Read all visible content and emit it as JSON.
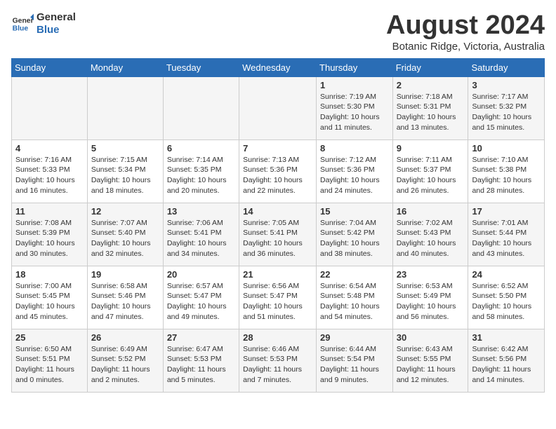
{
  "header": {
    "logo_line1": "General",
    "logo_line2": "Blue",
    "month_title": "August 2024",
    "subtitle": "Botanic Ridge, Victoria, Australia"
  },
  "weekdays": [
    "Sunday",
    "Monday",
    "Tuesday",
    "Wednesday",
    "Thursday",
    "Friday",
    "Saturday"
  ],
  "weeks": [
    [
      {
        "day": "",
        "info": ""
      },
      {
        "day": "",
        "info": ""
      },
      {
        "day": "",
        "info": ""
      },
      {
        "day": "",
        "info": ""
      },
      {
        "day": "1",
        "info": "Sunrise: 7:19 AM\nSunset: 5:30 PM\nDaylight: 10 hours\nand 11 minutes."
      },
      {
        "day": "2",
        "info": "Sunrise: 7:18 AM\nSunset: 5:31 PM\nDaylight: 10 hours\nand 13 minutes."
      },
      {
        "day": "3",
        "info": "Sunrise: 7:17 AM\nSunset: 5:32 PM\nDaylight: 10 hours\nand 15 minutes."
      }
    ],
    [
      {
        "day": "4",
        "info": "Sunrise: 7:16 AM\nSunset: 5:33 PM\nDaylight: 10 hours\nand 16 minutes."
      },
      {
        "day": "5",
        "info": "Sunrise: 7:15 AM\nSunset: 5:34 PM\nDaylight: 10 hours\nand 18 minutes."
      },
      {
        "day": "6",
        "info": "Sunrise: 7:14 AM\nSunset: 5:35 PM\nDaylight: 10 hours\nand 20 minutes."
      },
      {
        "day": "7",
        "info": "Sunrise: 7:13 AM\nSunset: 5:36 PM\nDaylight: 10 hours\nand 22 minutes."
      },
      {
        "day": "8",
        "info": "Sunrise: 7:12 AM\nSunset: 5:36 PM\nDaylight: 10 hours\nand 24 minutes."
      },
      {
        "day": "9",
        "info": "Sunrise: 7:11 AM\nSunset: 5:37 PM\nDaylight: 10 hours\nand 26 minutes."
      },
      {
        "day": "10",
        "info": "Sunrise: 7:10 AM\nSunset: 5:38 PM\nDaylight: 10 hours\nand 28 minutes."
      }
    ],
    [
      {
        "day": "11",
        "info": "Sunrise: 7:08 AM\nSunset: 5:39 PM\nDaylight: 10 hours\nand 30 minutes."
      },
      {
        "day": "12",
        "info": "Sunrise: 7:07 AM\nSunset: 5:40 PM\nDaylight: 10 hours\nand 32 minutes."
      },
      {
        "day": "13",
        "info": "Sunrise: 7:06 AM\nSunset: 5:41 PM\nDaylight: 10 hours\nand 34 minutes."
      },
      {
        "day": "14",
        "info": "Sunrise: 7:05 AM\nSunset: 5:41 PM\nDaylight: 10 hours\nand 36 minutes."
      },
      {
        "day": "15",
        "info": "Sunrise: 7:04 AM\nSunset: 5:42 PM\nDaylight: 10 hours\nand 38 minutes."
      },
      {
        "day": "16",
        "info": "Sunrise: 7:02 AM\nSunset: 5:43 PM\nDaylight: 10 hours\nand 40 minutes."
      },
      {
        "day": "17",
        "info": "Sunrise: 7:01 AM\nSunset: 5:44 PM\nDaylight: 10 hours\nand 43 minutes."
      }
    ],
    [
      {
        "day": "18",
        "info": "Sunrise: 7:00 AM\nSunset: 5:45 PM\nDaylight: 10 hours\nand 45 minutes."
      },
      {
        "day": "19",
        "info": "Sunrise: 6:58 AM\nSunset: 5:46 PM\nDaylight: 10 hours\nand 47 minutes."
      },
      {
        "day": "20",
        "info": "Sunrise: 6:57 AM\nSunset: 5:47 PM\nDaylight: 10 hours\nand 49 minutes."
      },
      {
        "day": "21",
        "info": "Sunrise: 6:56 AM\nSunset: 5:47 PM\nDaylight: 10 hours\nand 51 minutes."
      },
      {
        "day": "22",
        "info": "Sunrise: 6:54 AM\nSunset: 5:48 PM\nDaylight: 10 hours\nand 54 minutes."
      },
      {
        "day": "23",
        "info": "Sunrise: 6:53 AM\nSunset: 5:49 PM\nDaylight: 10 hours\nand 56 minutes."
      },
      {
        "day": "24",
        "info": "Sunrise: 6:52 AM\nSunset: 5:50 PM\nDaylight: 10 hours\nand 58 minutes."
      }
    ],
    [
      {
        "day": "25",
        "info": "Sunrise: 6:50 AM\nSunset: 5:51 PM\nDaylight: 11 hours\nand 0 minutes."
      },
      {
        "day": "26",
        "info": "Sunrise: 6:49 AM\nSunset: 5:52 PM\nDaylight: 11 hours\nand 2 minutes."
      },
      {
        "day": "27",
        "info": "Sunrise: 6:47 AM\nSunset: 5:53 PM\nDaylight: 11 hours\nand 5 minutes."
      },
      {
        "day": "28",
        "info": "Sunrise: 6:46 AM\nSunset: 5:53 PM\nDaylight: 11 hours\nand 7 minutes."
      },
      {
        "day": "29",
        "info": "Sunrise: 6:44 AM\nSunset: 5:54 PM\nDaylight: 11 hours\nand 9 minutes."
      },
      {
        "day": "30",
        "info": "Sunrise: 6:43 AM\nSunset: 5:55 PM\nDaylight: 11 hours\nand 12 minutes."
      },
      {
        "day": "31",
        "info": "Sunrise: 6:42 AM\nSunset: 5:56 PM\nDaylight: 11 hours\nand 14 minutes."
      }
    ]
  ]
}
